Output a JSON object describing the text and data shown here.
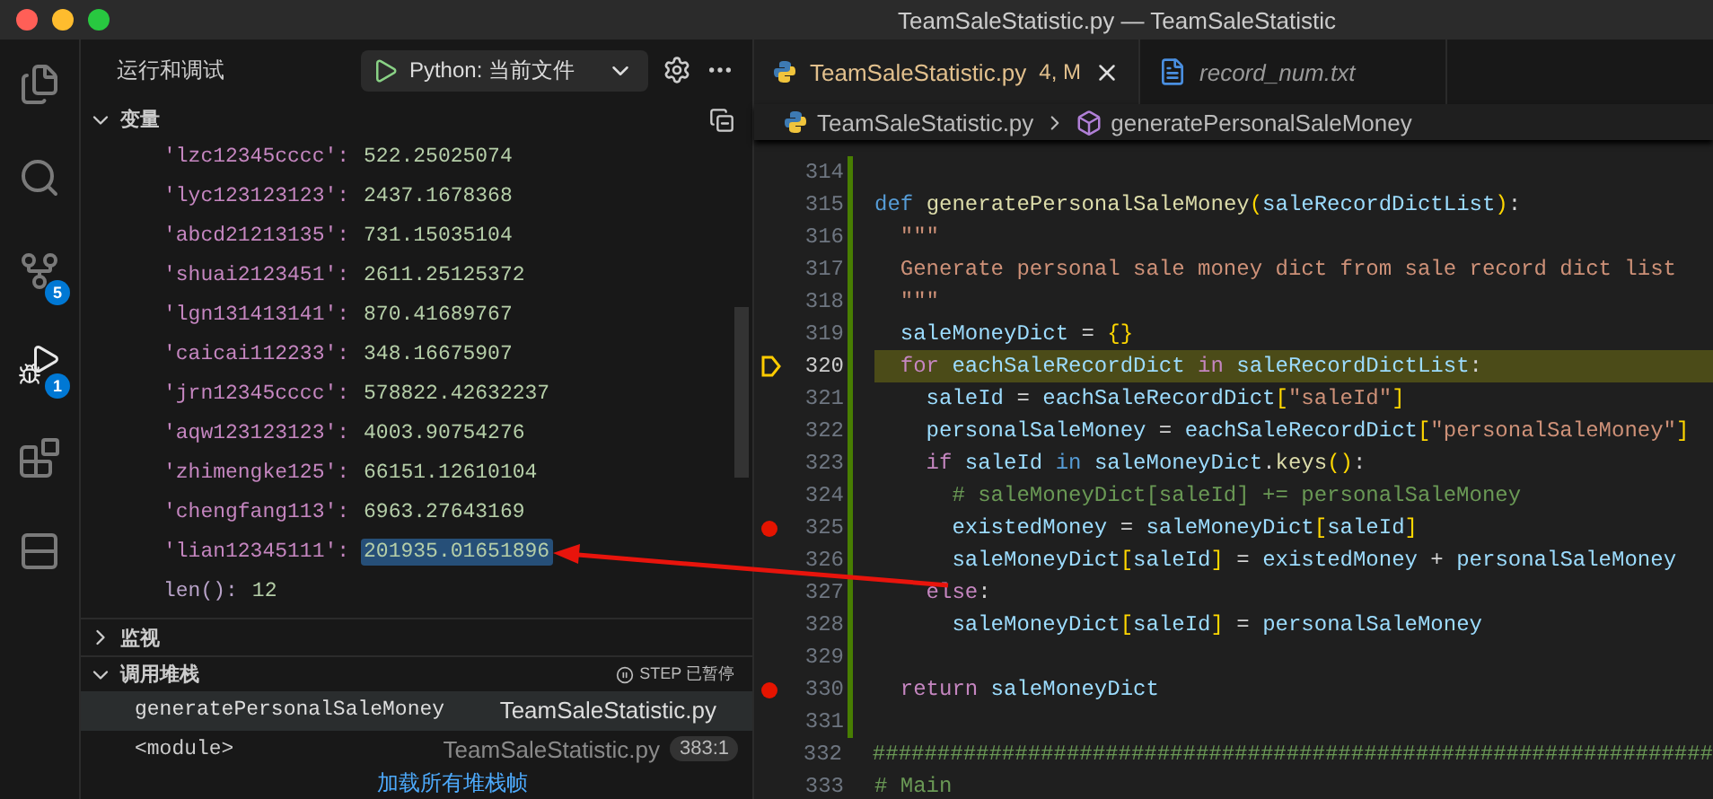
{
  "window": {
    "title": "TeamSaleStatistic.py — TeamSaleStatistic"
  },
  "activity_bar": [
    {
      "kind": "files",
      "selected": false
    },
    {
      "kind": "search",
      "selected": false
    },
    {
      "kind": "source_control",
      "badge": "5",
      "selected": false
    },
    {
      "kind": "debug",
      "badge": "1",
      "selected": true
    },
    {
      "kind": "extensions",
      "selected": false
    },
    {
      "kind": "panel",
      "selected": false
    }
  ],
  "sidebar": {
    "title": "运行和调试",
    "run_config": "Python: 当前文件",
    "variables": {
      "title": "变量",
      "expanded": true,
      "rows": [
        {
          "kind": "entry",
          "name": "'lzc12345cccc':",
          "value": "522.25025074",
          "selected": false
        },
        {
          "kind": "entry",
          "name": "'lyc123123123':",
          "value": "2437.1678368",
          "selected": false
        },
        {
          "kind": "entry",
          "name": "'abcd21213135':",
          "value": "731.15035104",
          "selected": false
        },
        {
          "kind": "entry",
          "name": "'shuai2123451':",
          "value": "2611.25125372",
          "selected": false
        },
        {
          "kind": "entry",
          "name": "'lgn131413141':",
          "value": "870.41689767",
          "selected": false
        },
        {
          "kind": "entry",
          "name": "'caicai112233':",
          "value": "348.16675907",
          "selected": false
        },
        {
          "kind": "entry",
          "name": "'jrn12345cccc':",
          "value": "578822.42632237",
          "selected": false
        },
        {
          "kind": "entry",
          "name": "'aqw123123123':",
          "value": "4003.90754276",
          "selected": false
        },
        {
          "kind": "entry",
          "name": "'zhimengke125':",
          "value": "66151.12610104",
          "selected": false
        },
        {
          "kind": "entry",
          "name": "'chengfang113':",
          "value": "6963.27643169",
          "selected": false
        },
        {
          "kind": "entry",
          "name": "'lian12345111':",
          "value": "201935.01651896",
          "selected": true
        },
        {
          "kind": "meta",
          "name": "len():",
          "value": "12",
          "selected": false
        }
      ]
    },
    "watch": {
      "title": "监视",
      "expanded": false
    },
    "call_stack": {
      "title": "调用堆栈",
      "status": "STEP 已暂停",
      "expanded": true,
      "frames": [
        {
          "function": "generatePersonalSaleMoney",
          "file": "TeamSaleStatistic.py",
          "selected": true
        },
        {
          "function": "<module>",
          "file": "TeamSaleStatistic.py",
          "position": "383:1",
          "selected": false
        }
      ],
      "load_more": "加载所有堆栈帧"
    }
  },
  "tabs": [
    {
      "kind": "python",
      "label": "TeamSaleStatistic.py",
      "status": "4, M",
      "preview": false,
      "selected": true
    },
    {
      "kind": "text",
      "label": "record_num.txt",
      "preview": true,
      "selected": false
    }
  ],
  "breadcrumbs": [
    {
      "kind": "python",
      "label": "TeamSaleStatistic.py"
    },
    {
      "kind": "symbol",
      "label": "generatePersonalSaleMoney"
    }
  ],
  "code": [
    {
      "number": "314",
      "breakpoint": false,
      "current": false
    },
    {
      "number": "315",
      "breakpoint": false,
      "current": false,
      "tokens": [
        {
          "kind": "def",
          "text": "def "
        },
        {
          "kind": "fn",
          "text": "generatePersonalSaleMoney"
        },
        {
          "kind": "brace",
          "text": "("
        },
        {
          "kind": "var",
          "text": "saleRecordDictList"
        },
        {
          "kind": "brace",
          "text": ")"
        },
        {
          "kind": "plain",
          "text": ":"
        }
      ]
    },
    {
      "number": "316",
      "breakpoint": false,
      "current": false,
      "tokens": [
        {
          "kind": "str",
          "text": "  \"\"\""
        }
      ]
    },
    {
      "number": "317",
      "breakpoint": false,
      "current": false,
      "tokens": [
        {
          "kind": "str",
          "text": "  Generate personal sale money dict from sale record dict list"
        }
      ]
    },
    {
      "number": "318",
      "breakpoint": false,
      "current": false,
      "tokens": [
        {
          "kind": "str",
          "text": "  \"\"\""
        }
      ]
    },
    {
      "number": "319",
      "breakpoint": false,
      "current": false,
      "tokens": [
        {
          "kind": "var",
          "text": "  saleMoneyDict"
        },
        {
          "kind": "plain",
          "text": " = "
        },
        {
          "kind": "brace",
          "text": "{}"
        }
      ]
    },
    {
      "number": "320",
      "breakpoint": false,
      "current": true,
      "tokens": [
        {
          "kind": "ctrl",
          "text": "  for"
        },
        {
          "kind": "var",
          "text": " eachSaleRecordDict"
        },
        {
          "kind": "ctrl",
          "text": " in"
        },
        {
          "kind": "var",
          "text": " saleRecordDictList"
        },
        {
          "kind": "plain",
          "text": ":"
        }
      ]
    },
    {
      "number": "321",
      "breakpoint": false,
      "current": false,
      "tokens": [
        {
          "kind": "var",
          "text": "    saleId"
        },
        {
          "kind": "plain",
          "text": " = "
        },
        {
          "kind": "var",
          "text": "eachSaleRecordDict"
        },
        {
          "kind": "brace",
          "text": "["
        },
        {
          "kind": "str",
          "text": "\"saleId\""
        },
        {
          "kind": "brace",
          "text": "]"
        }
      ]
    },
    {
      "number": "322",
      "breakpoint": false,
      "current": false,
      "tokens": [
        {
          "kind": "var",
          "text": "    personalSaleMoney"
        },
        {
          "kind": "plain",
          "text": " = "
        },
        {
          "kind": "var",
          "text": "eachSaleRecordDict"
        },
        {
          "kind": "brace",
          "text": "["
        },
        {
          "kind": "str",
          "text": "\"personalSaleMoney\""
        },
        {
          "kind": "brace",
          "text": "]"
        }
      ]
    },
    {
      "number": "323",
      "breakpoint": false,
      "current": false,
      "tokens": [
        {
          "kind": "ctrl",
          "text": "    if"
        },
        {
          "kind": "var",
          "text": " saleId"
        },
        {
          "kind": "def",
          "text": " in"
        },
        {
          "kind": "var",
          "text": " saleMoneyDict"
        },
        {
          "kind": "plain",
          "text": "."
        },
        {
          "kind": "fn",
          "text": "keys"
        },
        {
          "kind": "brace",
          "text": "()"
        },
        {
          "kind": "plain",
          "text": ":"
        }
      ]
    },
    {
      "number": "324",
      "breakpoint": false,
      "current": false,
      "tokens": [
        {
          "kind": "comment",
          "text": "      # saleMoneyDict[saleId] += personalSaleMoney"
        }
      ]
    },
    {
      "number": "325",
      "breakpoint": true,
      "current": false,
      "tokens": [
        {
          "kind": "var",
          "text": "      existedMoney"
        },
        {
          "kind": "plain",
          "text": " = "
        },
        {
          "kind": "var",
          "text": "saleMoneyDict"
        },
        {
          "kind": "brace",
          "text": "["
        },
        {
          "kind": "var",
          "text": "saleId"
        },
        {
          "kind": "brace",
          "text": "]"
        }
      ]
    },
    {
      "number": "326",
      "breakpoint": false,
      "current": false,
      "tokens": [
        {
          "kind": "var",
          "text": "      saleMoneyDict"
        },
        {
          "kind": "brace",
          "text": "["
        },
        {
          "kind": "var",
          "text": "saleId"
        },
        {
          "kind": "brace",
          "text": "]"
        },
        {
          "kind": "plain",
          "text": " = "
        },
        {
          "kind": "var",
          "text": "existedMoney"
        },
        {
          "kind": "plain",
          "text": " + "
        },
        {
          "kind": "var",
          "text": "personalSaleMoney"
        }
      ]
    },
    {
      "number": "327",
      "breakpoint": false,
      "current": false,
      "tokens": [
        {
          "kind": "ctrl",
          "text": "    else"
        },
        {
          "kind": "plain",
          "text": ":"
        }
      ]
    },
    {
      "number": "328",
      "breakpoint": false,
      "current": false,
      "tokens": [
        {
          "kind": "var",
          "text": "      saleMoneyDict"
        },
        {
          "kind": "brace",
          "text": "["
        },
        {
          "kind": "var",
          "text": "saleId"
        },
        {
          "kind": "brace",
          "text": "]"
        },
        {
          "kind": "plain",
          "text": " = "
        },
        {
          "kind": "var",
          "text": "personalSaleMoney"
        }
      ]
    },
    {
      "number": "329",
      "breakpoint": false,
      "current": false
    },
    {
      "number": "330",
      "breakpoint": true,
      "current": false,
      "tokens": [
        {
          "kind": "ctrl",
          "text": "  return"
        },
        {
          "kind": "var",
          "text": " saleMoneyDict"
        }
      ]
    },
    {
      "number": "331",
      "breakpoint": false,
      "current": false
    },
    {
      "number": "332",
      "breakpoint": false,
      "current": false,
      "tokens": [
        {
          "kind": "comment",
          "text": "#################################################################"
        }
      ]
    },
    {
      "number": "333",
      "breakpoint": false,
      "current": false,
      "tokens": [
        {
          "kind": "comment",
          "text": "# Main"
        }
      ]
    }
  ]
}
